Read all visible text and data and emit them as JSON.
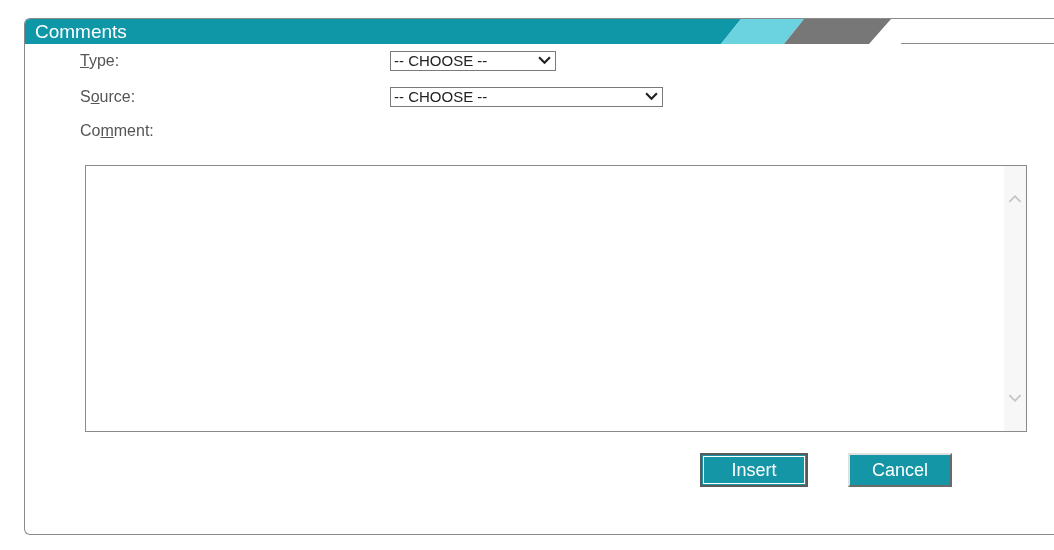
{
  "panel": {
    "title": "Comments"
  },
  "fields": [
    {
      "kind": "select",
      "label": [
        {
          "text": "T",
          "underline": true
        },
        {
          "text": "ype:",
          "underline": false
        }
      ],
      "value": "-- CHOOSE --"
    },
    {
      "kind": "select",
      "label": [
        {
          "text": "S",
          "underline": false
        },
        {
          "text": "o",
          "underline": true
        },
        {
          "text": "urce:",
          "underline": false
        }
      ],
      "value": "-- CHOOSE --"
    },
    {
      "kind": "textarea",
      "label": [
        {
          "text": "Co",
          "underline": false
        },
        {
          "text": "m",
          "underline": true
        },
        {
          "text": "ment:",
          "underline": false
        }
      ]
    }
  ],
  "buttons": [
    {
      "label": "Insert",
      "focused": true
    },
    {
      "label": "Cancel",
      "focused": false
    }
  ]
}
